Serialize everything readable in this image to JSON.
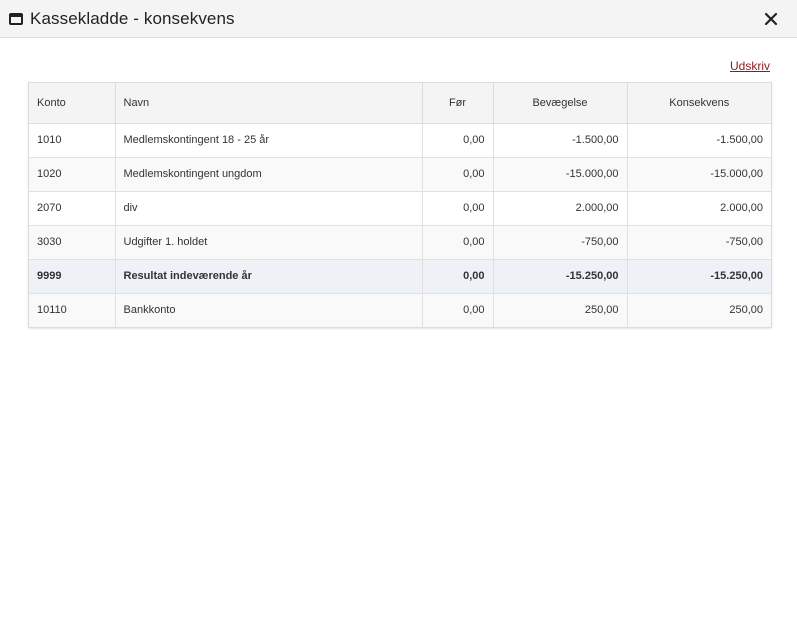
{
  "dialog": {
    "title": "Kassekladde - konsekvens",
    "print_link": "Udskriv"
  },
  "table": {
    "headers": {
      "konto": "Konto",
      "navn": "Navn",
      "foer": "Før",
      "bevaegelse": "Bevægelse",
      "konsekvens": "Konsekvens"
    },
    "rows": [
      {
        "konto": "1010",
        "navn": "Medlemskontingent 18 - 25 år",
        "foer": "0,00",
        "bevaegelse": "-1.500,00",
        "konsekvens": "-1.500,00"
      },
      {
        "konto": "1020",
        "navn": "Medlemskontingent ungdom",
        "foer": "0,00",
        "bevaegelse": "-15.000,00",
        "konsekvens": "-15.000,00"
      },
      {
        "konto": "2070",
        "navn": "div",
        "foer": "0,00",
        "bevaegelse": "2.000,00",
        "konsekvens": "2.000,00"
      },
      {
        "konto": "3030",
        "navn": "Udgifter 1. holdet",
        "foer": "0,00",
        "bevaegelse": "-750,00",
        "konsekvens": "-750,00"
      },
      {
        "konto": "9999",
        "navn": "Resultat indeværende år",
        "foer": "0,00",
        "bevaegelse": "-15.250,00",
        "konsekvens": "-15.250,00"
      },
      {
        "konto": "10110",
        "navn": "Bankkonto",
        "foer": "0,00",
        "bevaegelse": "250,00",
        "konsekvens": "250,00"
      }
    ]
  },
  "colors": {
    "link": "#8b1a1a",
    "header_bg": "#f4f4f4",
    "total_row_bg": "#eef1f6"
  },
  "icons": {
    "window": "window-icon",
    "close": "close-icon"
  }
}
